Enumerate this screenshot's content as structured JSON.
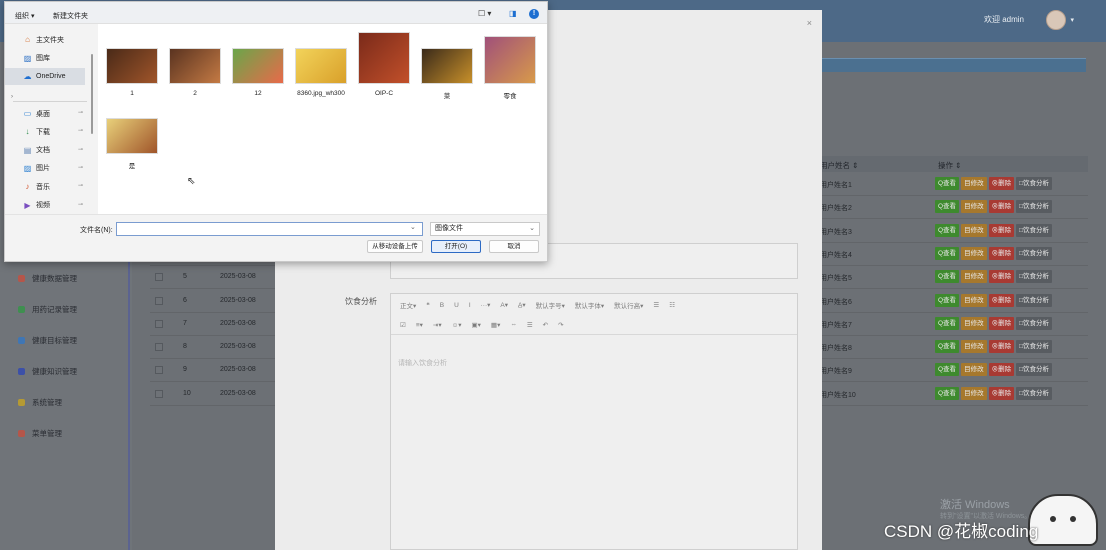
{
  "app": {
    "welcome": "欢迎 admin",
    "sidebar": [
      {
        "label": "健康数据管理",
        "color": "#b5564a"
      },
      {
        "label": "用药记录管理",
        "color": "#3f8f50"
      },
      {
        "label": "健康目标管理",
        "color": "#3f76b5"
      },
      {
        "label": "健康知识管理",
        "color": "#3c50a8"
      },
      {
        "label": "系统管理",
        "color": "#b59a33"
      },
      {
        "label": "菜单管理",
        "color": "#b5564a"
      }
    ],
    "table": {
      "col_username": "用户姓名 ⇕",
      "col_ops": "操作 ⇕",
      "rows": [
        {
          "idx": "",
          "date": "",
          "user": "用户姓名1"
        },
        {
          "idx": "",
          "date": "",
          "user": "用户姓名2"
        },
        {
          "idx": "",
          "date": "",
          "user": "用户姓名3"
        },
        {
          "idx": "",
          "date": "",
          "user": "用户姓名4"
        },
        {
          "idx": "5",
          "date": "2025-03-08",
          "user": "用户姓名5"
        },
        {
          "idx": "6",
          "date": "2025-03-08",
          "user": "用户姓名6"
        },
        {
          "idx": "7",
          "date": "2025-03-08",
          "user": "用户姓名7"
        },
        {
          "idx": "8",
          "date": "2025-03-08",
          "user": "用户姓名8"
        },
        {
          "idx": "9",
          "date": "2025-03-08",
          "user": "用户姓名9"
        },
        {
          "idx": "10",
          "date": "2025-03-08",
          "user": "用户姓名10"
        }
      ],
      "ops": {
        "view": "Q查看",
        "edit": "目修改",
        "del": "⊗删除",
        "ana": "□饮食分析"
      }
    }
  },
  "modal": {
    "diet_label": "饮食分析",
    "editor_placeholder": "请输入饮食分析",
    "toolbar_row1": [
      "正文▾",
      "❝",
      "B",
      "U",
      "I",
      "···▾",
      "A▾",
      "A̲▾",
      "默认字号▾",
      "默认字体▾",
      "默认行高▾",
      "☰",
      "☷"
    ],
    "toolbar_row2": [
      "☑",
      "≡▾",
      "⇥▾",
      "☺▾",
      "▣▾",
      "▦▾",
      "⇔",
      "☰",
      "↶",
      "↷"
    ]
  },
  "dialog": {
    "toolbar": {
      "organize": "组织 ▾",
      "new_folder": "新建文件夹",
      "view_icon": "☐ ▾",
      "pane_icon": "◨",
      "help": "!"
    },
    "nav": [
      {
        "label": "主文件夹",
        "icon": "home-icon",
        "glyph": "⌂",
        "color": "#d36b2a",
        "pinned": false
      },
      {
        "label": "图库",
        "icon": "gallery-icon",
        "glyph": "▨",
        "color": "#2b6fc4",
        "pinned": false
      },
      {
        "label": "OneDrive",
        "icon": "cloud-icon",
        "glyph": "☁",
        "color": "#1f6fd0",
        "pinned": false
      },
      {
        "label": "桌面",
        "icon": "desktop-icon",
        "glyph": "▭",
        "color": "#2b7fd0",
        "pinned": true
      },
      {
        "label": "下载",
        "icon": "download-icon",
        "glyph": "↓",
        "color": "#2a8a4a",
        "pinned": true
      },
      {
        "label": "文档",
        "icon": "document-icon",
        "glyph": "▤",
        "color": "#5a7fb0",
        "pinned": true
      },
      {
        "label": "图片",
        "icon": "picture-icon",
        "glyph": "▨",
        "color": "#2b7fd0",
        "pinned": true
      },
      {
        "label": "音乐",
        "icon": "music-icon",
        "glyph": "♪",
        "color": "#d0502a",
        "pinned": true
      },
      {
        "label": "视频",
        "icon": "video-icon",
        "glyph": "▶",
        "color": "#7a4fc0",
        "pinned": true
      }
    ],
    "files": [
      {
        "name": "1",
        "colors": [
          "#4a2a18",
          "#a0552a"
        ]
      },
      {
        "name": "2",
        "colors": [
          "#5a3320",
          "#c47a44"
        ]
      },
      {
        "name": "12",
        "colors": [
          "#6aa64a",
          "#e86a4a"
        ]
      },
      {
        "name": "8360.jpg_wh300",
        "colors": [
          "#f2d35a",
          "#d9a02a"
        ]
      },
      {
        "name": "OIP-C",
        "colors": [
          "#7a2a1a",
          "#c2502a"
        ]
      },
      {
        "name": "菜",
        "colors": [
          "#3a2a1a",
          "#c8902a"
        ]
      },
      {
        "name": "零食",
        "colors": [
          "#a0507a",
          "#d89a4a"
        ]
      },
      {
        "name": "是",
        "colors": [
          "#e8d07a",
          "#a0552a"
        ]
      }
    ],
    "filename_label": "文件名(N):",
    "filename_value": "",
    "filetype": "图像文件",
    "btn_mobile": "从移动设备上传",
    "btn_open": "打开(O)",
    "btn_cancel": "取消"
  },
  "watermark": {
    "activate": "激活 Windows",
    "activate_sub": "转到\"设置\"以激活 Windows。",
    "csdn": "CSDN @花椒coding"
  }
}
